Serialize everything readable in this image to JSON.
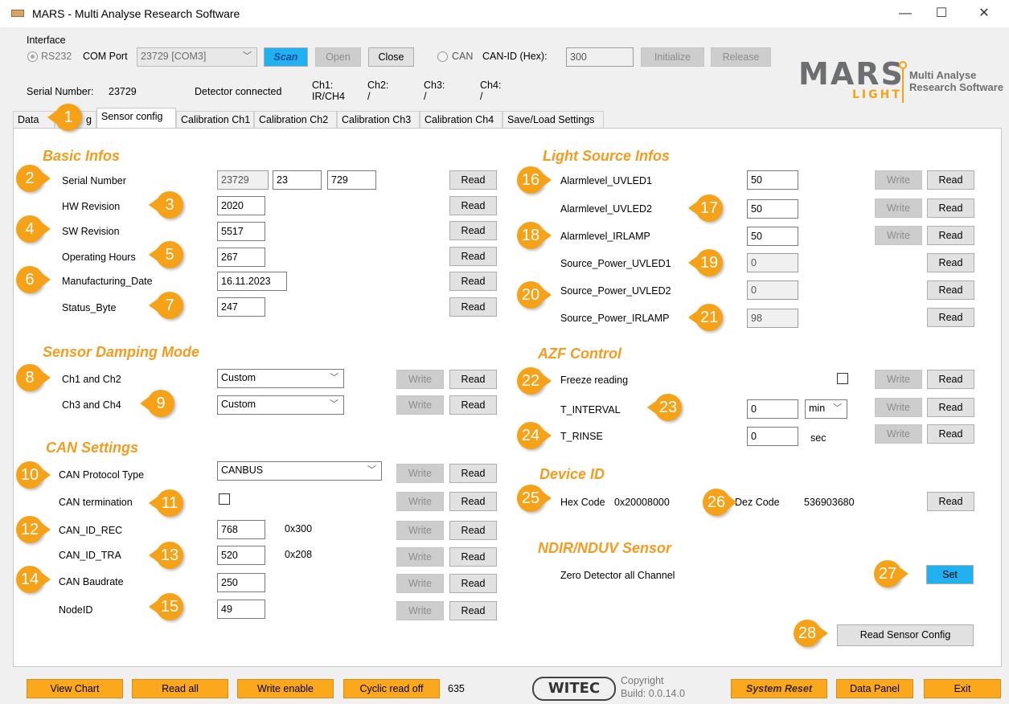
{
  "window": {
    "title": "MARS - Multi Analyse Research Software",
    "minimize": "—",
    "maximize": "☐",
    "close": "✕"
  },
  "interface": {
    "group_label": "Interface",
    "rs232_label": "RS232",
    "com_port_label": "COM Port",
    "com_port_value": "23729 [COM3]",
    "scan": "Scan",
    "open": "Open",
    "close": "Close",
    "can_label": "CAN",
    "can_id_label": "CAN-ID (Hex):",
    "can_id_value": "300",
    "initialize": "Initialize",
    "release": "Release"
  },
  "logo": {
    "mars": "MARS",
    "light": "LIGHT",
    "sub1": "Multi Analyse",
    "sub2": "Research Software"
  },
  "status": {
    "serial_label": "Serial Number:",
    "serial_value": "23729",
    "detector": "Detector connected",
    "ch1": "Ch1:",
    "ch1_val": "IR/CH4",
    "ch2": "Ch2:",
    "ch2_val": "/",
    "ch3": "Ch3:",
    "ch3_val": "/",
    "ch4": "Ch4:",
    "ch4_val": "/"
  },
  "tabs": [
    "Data",
    "g",
    "Sensor config",
    "Calibration Ch1",
    "Calibration Ch2",
    "Calibration Ch3",
    "Calibration Ch4",
    "Save/Load Settings"
  ],
  "basic": {
    "title": "Basic Infos",
    "serial_label": "Serial Number",
    "serial_a": "23729",
    "serial_b": "23",
    "serial_c": "729",
    "hw_label": "HW Revision",
    "hw_value": "2020",
    "sw_label": "SW Revision",
    "sw_value": "5517",
    "hours_label": "Operating Hours",
    "hours_value": "267",
    "mfg_label": "Manufacturing_Date",
    "mfg_value": "16.11.2023",
    "status_label": "Status_Byte",
    "status_value": "247"
  },
  "damping": {
    "title": "Sensor Damping Mode",
    "ch12_label": "Ch1 and Ch2",
    "ch12_value": "Custom",
    "ch34_label": "Ch3 and Ch4",
    "ch34_value": "Custom"
  },
  "can": {
    "title": "CAN Settings",
    "protocol_label": "CAN Protocol Type",
    "protocol_value": "CANBUS",
    "termination_label": "CAN termination",
    "rec_label": "CAN_ID_REC",
    "rec_value": "768",
    "rec_hex": "0x300",
    "tra_label": "CAN_ID_TRA",
    "tra_value": "520",
    "tra_hex": "0x208",
    "baud_label": "CAN Baudrate",
    "baud_value": "250",
    "node_label": "NodeID",
    "node_value": "49"
  },
  "light": {
    "title": "Light Source Infos",
    "alarm_uv1_label": "Alarmlevel_UVLED1",
    "alarm_uv1_value": "50",
    "alarm_uv2_label": "Alarmlevel_UVLED2",
    "alarm_uv2_value": "50",
    "alarm_ir_label": "Alarmlevel_IRLAMP",
    "alarm_ir_value": "50",
    "power_uv1_label": "Source_Power_UVLED1",
    "power_uv1_value": "0",
    "power_uv2_label": "Source_Power_UVLED2",
    "power_uv2_value": "0",
    "power_ir_label": "Source_Power_IRLAMP",
    "power_ir_value": "98"
  },
  "azf": {
    "title": "AZF Control",
    "freeze_label": "Freeze reading",
    "interval_label": "T_INTERVAL",
    "interval_value": "0",
    "interval_unit": "min",
    "rinse_label": "T_RINSE",
    "rinse_value": "0",
    "rinse_unit": "sec"
  },
  "device": {
    "title": "Device ID",
    "hex_label": "Hex Code",
    "hex_value": "0x20008000",
    "dez_label": "Dez Code",
    "dez_value": "536903680"
  },
  "ndir": {
    "title": "NDIR/NDUV Sensor",
    "zero_label": "Zero Detector all Channel",
    "set": "Set"
  },
  "buttons": {
    "read": "Read",
    "write": "Write",
    "read_sensor_config": "Read Sensor Config"
  },
  "bottom": {
    "view_chart": "View Chart",
    "read_all": "Read all",
    "write_enable": "Write enable",
    "cyclic_read": "Cyclic read off",
    "count": "635",
    "witec": "WITEC",
    "copyright": "Copyright",
    "build": "Build: 0.0.14.0",
    "system_reset": "System Reset",
    "data_panel": "Data Panel",
    "exit": "Exit"
  },
  "badges": [
    "1",
    "2",
    "3",
    "4",
    "5",
    "6",
    "7",
    "8",
    "9",
    "10",
    "11",
    "12",
    "13",
    "14",
    "15",
    "16",
    "17",
    "18",
    "19",
    "20",
    "21",
    "22",
    "23",
    "24",
    "25",
    "26",
    "27",
    "28"
  ],
  "colors": {
    "accent_orange": "#f5a218",
    "section_orange": "#f39c1f",
    "scan_blue": "#21b0f0"
  }
}
